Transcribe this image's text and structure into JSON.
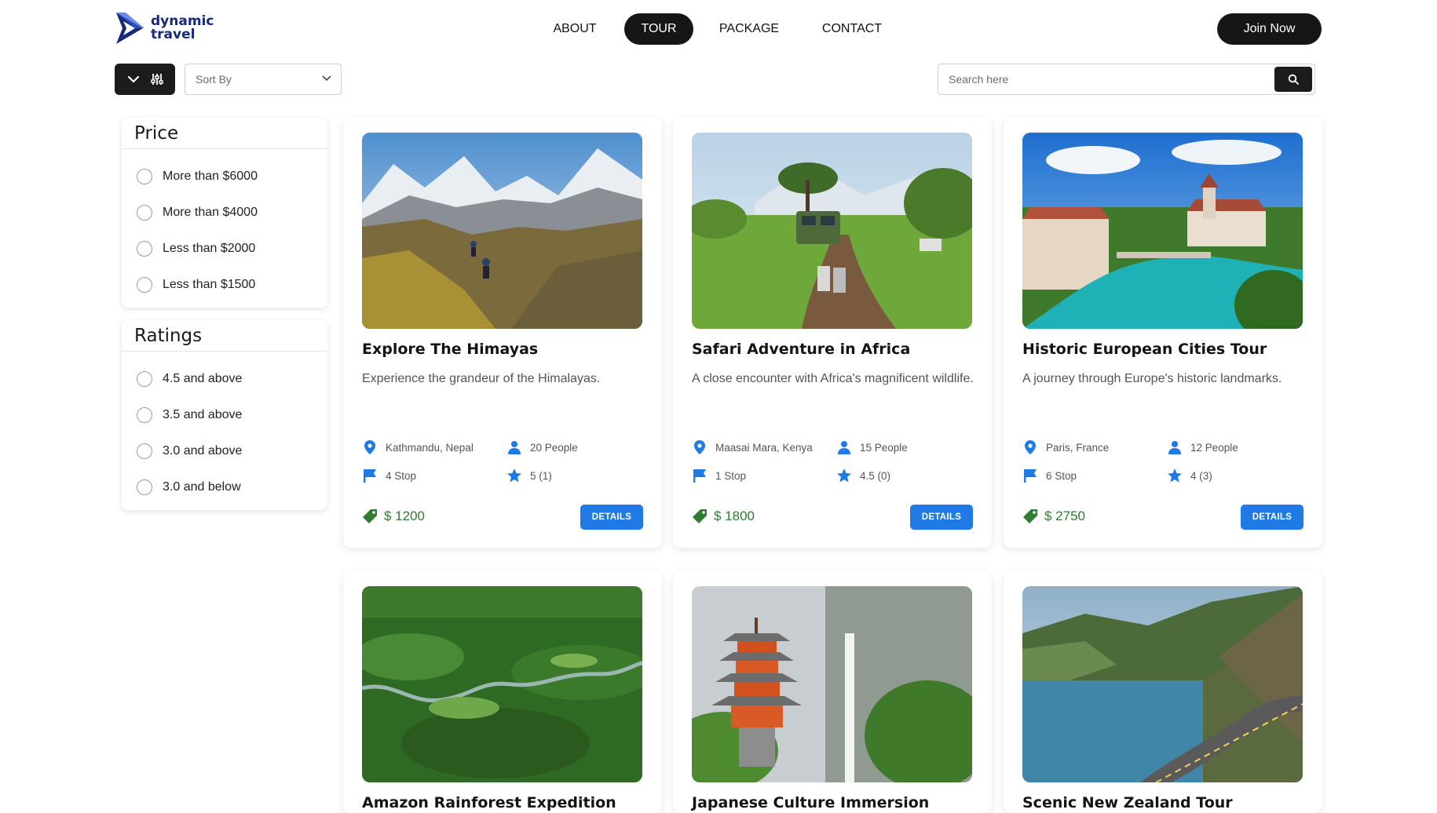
{
  "brand": {
    "line1": "dynamic",
    "line2": "travel",
    "color": "#16297a"
  },
  "nav": [
    {
      "label": "ABOUT",
      "active": false
    },
    {
      "label": "TOUR",
      "active": true
    },
    {
      "label": "PACKAGE",
      "active": false
    },
    {
      "label": "CONTACT",
      "active": false
    }
  ],
  "join_label": "Join Now",
  "toolbar": {
    "sort_placeholder": "Sort By",
    "search_placeholder": "Search here"
  },
  "filters": {
    "price": {
      "title": "Price",
      "options": [
        "More than $6000",
        "More than $4000",
        "Less than $2000",
        "Less than $1500"
      ]
    },
    "ratings": {
      "title": "Ratings",
      "options": [
        "4.5 and above",
        "3.5 and above",
        "3.0 and above",
        "3.0 and below"
      ]
    }
  },
  "details_label": "DETAILS",
  "tours": [
    {
      "title": "Explore The Himayas",
      "description": "Experience the grandeur of the Himalayas.",
      "location": "Kathmandu, Nepal",
      "people": "20 People",
      "stops": "4 Stop",
      "rating": "5 (1)",
      "price": "$ 1200"
    },
    {
      "title": "Safari Adventure in Africa",
      "description": "A close encounter with Africa's magnificent wildlife.",
      "location": "Maasai Mara, Kenya",
      "people": "15 People",
      "stops": "1 Stop",
      "rating": "4.5 (0)",
      "price": "$ 1800"
    },
    {
      "title": "Historic European Cities Tour",
      "description": "A journey through Europe's historic landmarks.",
      "location": "Paris, France",
      "people": "12 People",
      "stops": "6 Stop",
      "rating": "4 (3)",
      "price": "$ 2750"
    },
    {
      "title": "Amazon Rainforest Expedition"
    },
    {
      "title": "Japanese Culture Immersion"
    },
    {
      "title": "Scenic New Zealand Tour"
    }
  ],
  "colors": {
    "accent": "#1f7ae6",
    "price": "#2e7d32",
    "dark": "#161616"
  }
}
